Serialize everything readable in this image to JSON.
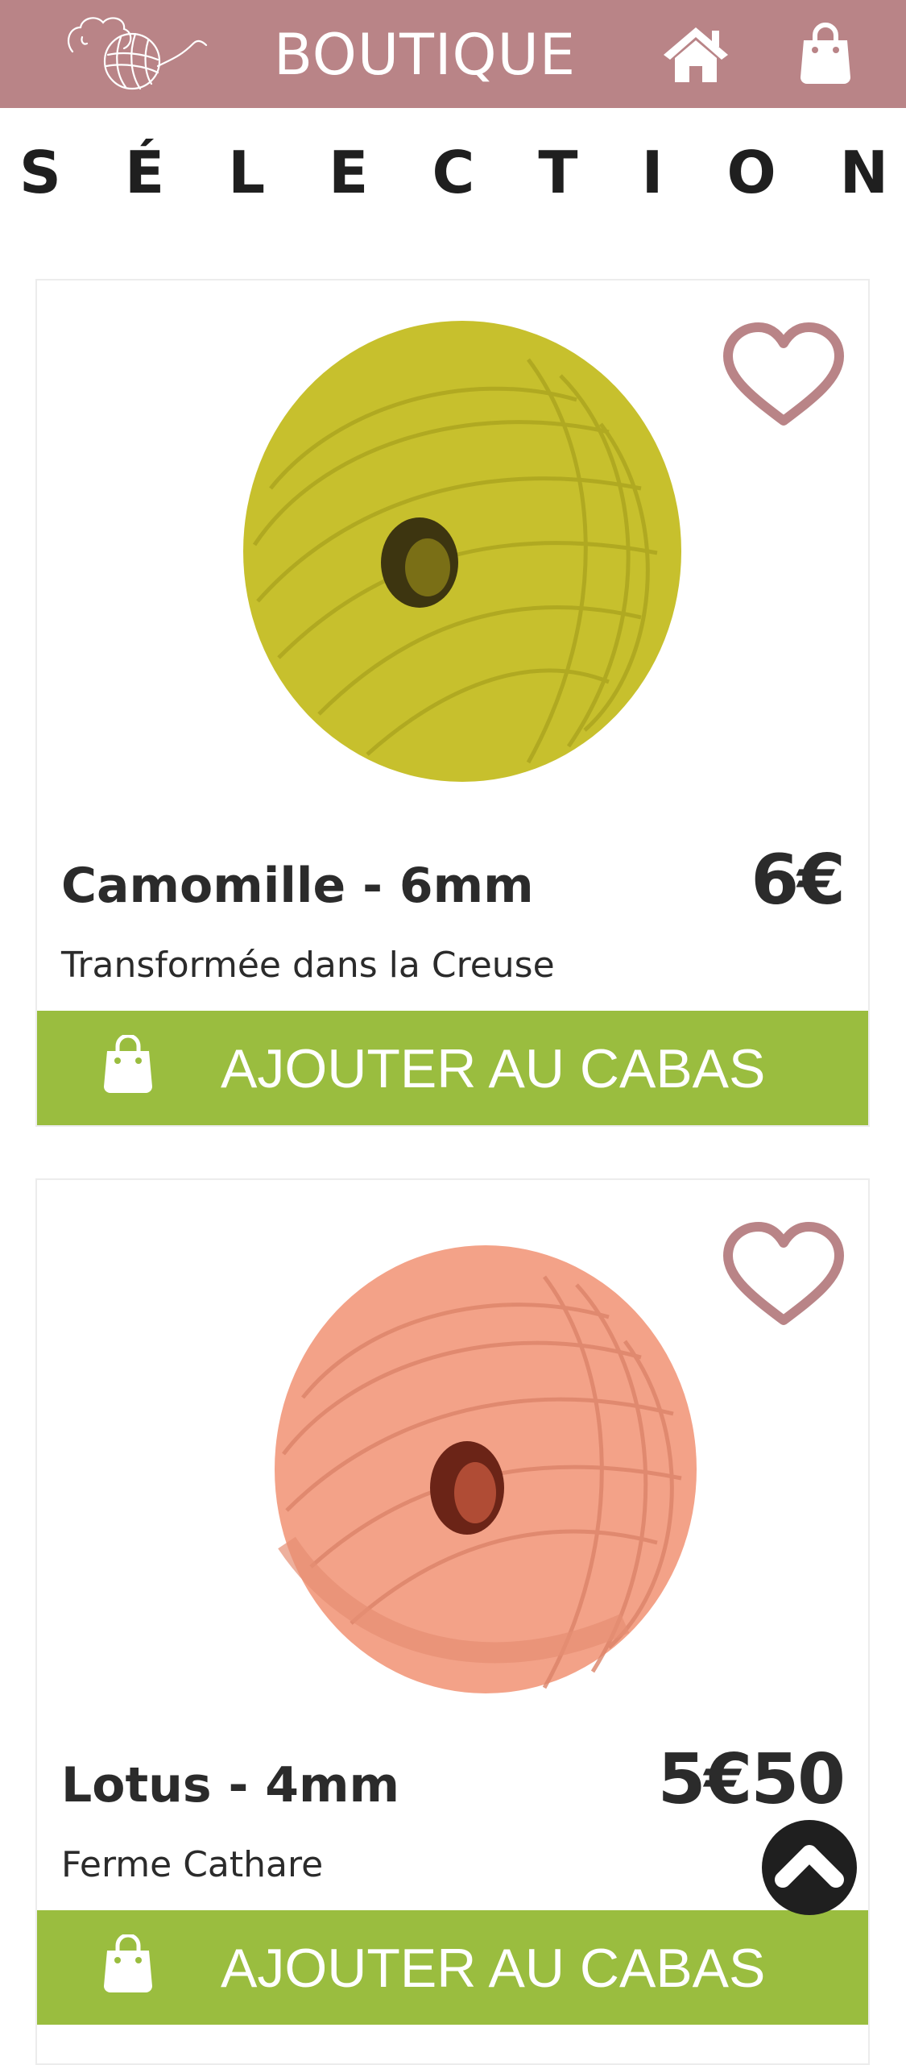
{
  "header": {
    "brand": "BOUTIQUE",
    "logo_icon": "sheep-yarn-logo-icon",
    "home_icon": "home-icon",
    "bag_icon": "shopping-bag-icon",
    "background": "#b98487"
  },
  "section": {
    "letters": [
      "S",
      "É",
      "L",
      "E",
      "C",
      "T",
      "I",
      "O",
      "N"
    ]
  },
  "products": [
    {
      "name": "Camomille - 6mm",
      "price": "6€",
      "origin": "Transformée dans la Creuse",
      "button_label": "AJOUTER AU CABAS",
      "yarn_color": "#c7c02d",
      "favorite_icon": "heart-outline-icon"
    },
    {
      "name": "Lotus - 4mm",
      "price": "5€50",
      "origin": "Ferme Cathare",
      "button_label": "AJOUTER AU CABAS",
      "yarn_color": "#f3a288",
      "favorite_icon": "heart-outline-icon"
    }
  ],
  "colors": {
    "accent": "#b98487",
    "button": "#9abd3f",
    "text": "#2b2b2b"
  },
  "scroll_top_icon": "chevron-up-icon"
}
